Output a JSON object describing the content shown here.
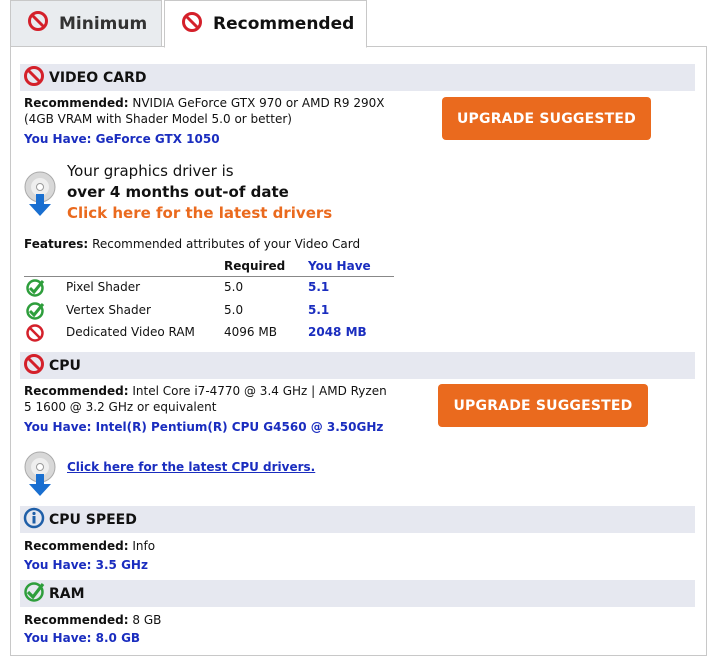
{
  "tabs": [
    {
      "label": "Minimum",
      "active": false
    },
    {
      "label": "Recommended",
      "active": true
    }
  ],
  "video_card": {
    "title": "VIDEO CARD",
    "recommended_label": "Recommended:",
    "recommended_line1": "NVIDIA GeForce GTX 970 or AMD R9 290X",
    "recommended_line2": "(4GB VRAM with Shader Model 5.0 or better)",
    "you_have": "You Have: GeForce GTX 1050",
    "button": "UPGRADE SUGGESTED",
    "driver_line1": "Your graphics driver is",
    "driver_line2": "over 4 months out-of date",
    "driver_link": "Click here for the latest drivers",
    "features_label": "Features:",
    "features_text": "Recommended attributes of your Video Card",
    "col_required": "Required",
    "col_you_have": "You Have",
    "rows": [
      {
        "status": "check",
        "name": "Pixel Shader",
        "required": "5.0",
        "have": "5.1"
      },
      {
        "status": "fail",
        "name": "Vertex Shader",
        "required": "5.0",
        "have": "5.1"
      },
      {
        "status": "fail",
        "name": "Dedicated Video RAM",
        "required": "4096 MB",
        "have": "2048 MB"
      }
    ]
  },
  "cpu": {
    "title": "CPU",
    "recommended_label": "Recommended:",
    "recommended_line1": "Intel Core i7-4770 @ 3.4 GHz | AMD Ryzen",
    "recommended_line2": "5 1600 @ 3.2 GHz or equivalent",
    "you_have": "You Have: Intel(R) Pentium(R) CPU G4560 @ 3.50GHz",
    "button": "UPGRADE SUGGESTED",
    "driver_link": "Click here for the latest CPU drivers."
  },
  "cpu_speed": {
    "title": "CPU SPEED",
    "recommended_label": "Recommended:",
    "recommended_value": "Info",
    "you_have": "You Have: 3.5 GHz"
  },
  "ram": {
    "title": "RAM",
    "recommended_label": "Recommended:",
    "recommended_value": "8 GB",
    "you_have": "You Have: 8.0 GB"
  },
  "colors": {
    "fail": "#d4202a",
    "check": "#2e9e3c",
    "info": "#1f5fa8",
    "accent": "#ea6a1e",
    "link": "#1a2dbf"
  }
}
